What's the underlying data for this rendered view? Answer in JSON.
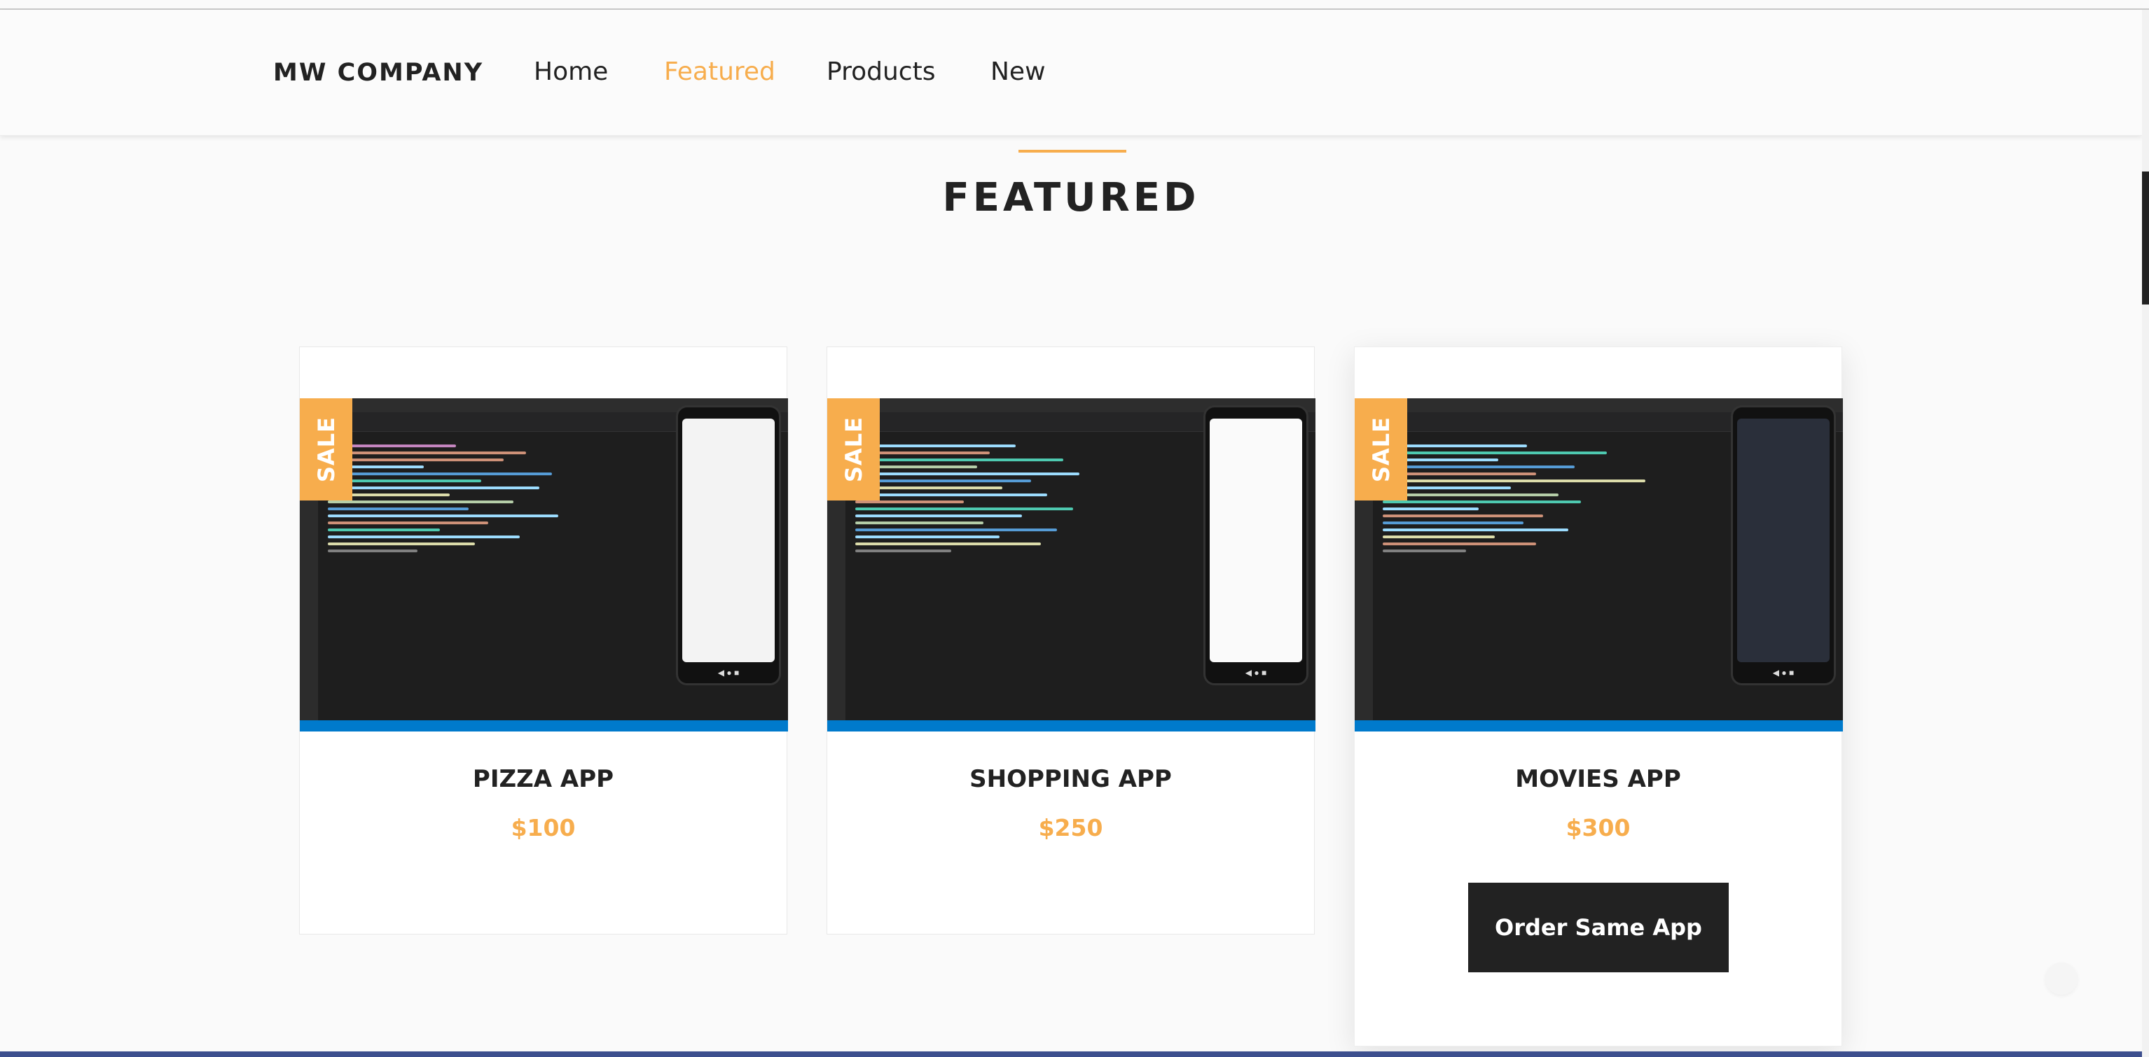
{
  "nav": {
    "brand": "MW COMPANY",
    "links": [
      "Home",
      "Featured",
      "Products",
      "New"
    ],
    "active": "Featured",
    "accent_color": "#f7ad4d"
  },
  "section": {
    "title": "FEATURED"
  },
  "products": [
    {
      "badge": "SALE",
      "title": "PIZZA APP",
      "price": "$100",
      "thumbnail_icon": "vscode-screenshot-pizza-app"
    },
    {
      "badge": "SALE",
      "title": "SHOPPING APP",
      "price": "$250",
      "thumbnail_icon": "vscode-screenshot-shopping-app"
    },
    {
      "badge": "SALE",
      "title": "MOVIES APP",
      "price": "$300",
      "thumbnail_icon": "vscode-screenshot-movies-app",
      "button": "Order Same App"
    }
  ]
}
